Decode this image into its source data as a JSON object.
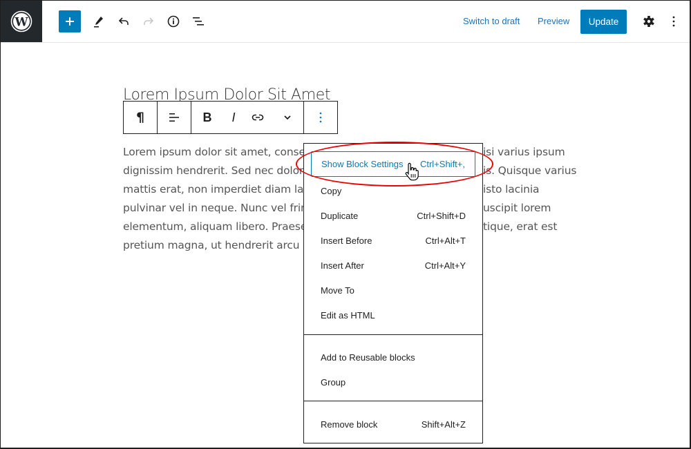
{
  "topbar": {
    "logo": "wordpress-logo",
    "tools": [
      {
        "name": "add-block",
        "icon": "plus-icon"
      },
      {
        "name": "tools",
        "icon": "pencil-icon"
      },
      {
        "name": "undo",
        "icon": "undo-icon"
      },
      {
        "name": "redo",
        "icon": "redo-icon",
        "disabled": true
      },
      {
        "name": "details",
        "icon": "info-icon"
      },
      {
        "name": "list-view",
        "icon": "list-view-icon"
      }
    ],
    "switch_to_draft": "Switch to draft",
    "preview": "Preview",
    "update": "Update",
    "settings_icon": "gear-icon",
    "options_icon": "vertical-ellipsis-icon"
  },
  "post": {
    "title": "Lorem Ipsum Dolor Sit Amet",
    "paragraph_lines": [
      "Lorem ipsum dolor sit amet, consec",
      "dignissim hendrerit. Sed nec dolor",
      "mattis erat, non imperdiet diam lac",
      "pulvinar vel in neque. Nunc vel fring",
      "elementum, aliquam libero. Praese",
      "pretium magna, ut hendrerit arcu m"
    ],
    "paragraph_right_lines": [
      "isi varius ipsum",
      "is. Quisque varius",
      "isto lacinia",
      "uscipit lorem",
      "tique, erat est",
      ""
    ]
  },
  "block_toolbar": {
    "buttons": [
      {
        "name": "paragraph",
        "glyph": "¶"
      },
      {
        "name": "align",
        "icon": "align-left-icon"
      },
      {
        "name": "bold",
        "glyph": "B"
      },
      {
        "name": "italic",
        "glyph": "I"
      },
      {
        "name": "link",
        "icon": "link-icon"
      },
      {
        "name": "more-rich-text",
        "icon": "chevron-down-icon"
      },
      {
        "name": "options",
        "icon": "vertical-ellipsis-icon"
      }
    ]
  },
  "menu": {
    "groups": [
      [
        {
          "label": "Show Block Settings",
          "shortcut": "Ctrl+Shift+,",
          "active": true
        },
        {
          "label": "Copy",
          "shortcut": ""
        },
        {
          "label": "Duplicate",
          "shortcut": "Ctrl+Shift+D"
        },
        {
          "label": "Insert Before",
          "shortcut": "Ctrl+Alt+T"
        },
        {
          "label": "Insert After",
          "shortcut": "Ctrl+Alt+Y"
        },
        {
          "label": "Move To",
          "shortcut": ""
        },
        {
          "label": "Edit as HTML",
          "shortcut": ""
        }
      ],
      [
        {
          "label": "Add to Reusable blocks",
          "shortcut": ""
        },
        {
          "label": "Group",
          "shortcut": ""
        }
      ],
      [
        {
          "label": "Remove block",
          "shortcut": "Shift+Alt+Z"
        }
      ]
    ]
  },
  "colors": {
    "accent": "#007cba",
    "dark": "#23282d",
    "annotation": "#e00000"
  }
}
